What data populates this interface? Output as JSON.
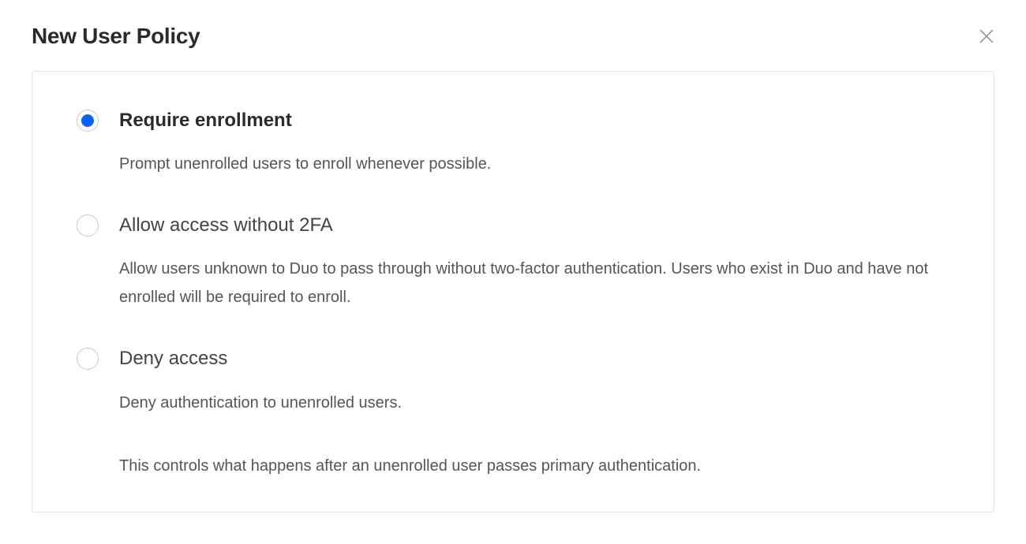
{
  "header": {
    "title": "New User Policy"
  },
  "options": [
    {
      "title": "Require enrollment",
      "description": "Prompt unenrolled users to enroll whenever possible.",
      "selected": true
    },
    {
      "title": "Allow access without 2FA",
      "description": "Allow users unknown to Duo to pass through without two-factor authentication. Users who exist in Duo and have not enrolled will be required to enroll.",
      "selected": false
    },
    {
      "title": "Deny access",
      "description": "Deny authentication to unenrolled users.",
      "selected": false
    }
  ],
  "footer_note": "This controls what happens after an unenrolled user passes primary authentication."
}
